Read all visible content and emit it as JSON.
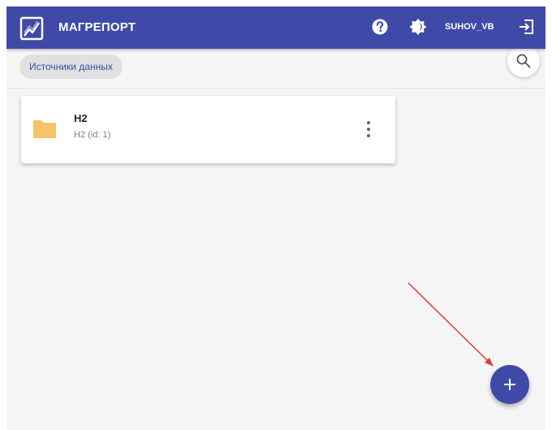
{
  "header": {
    "app_title": "МАГРЕПОРТ",
    "logo_icon": "chart-line-logo-icon",
    "help_icon": "help-circle-icon",
    "theme_icon": "theme-toggle-icon",
    "username": "SUHOV_VB",
    "logout_icon": "logout-icon"
  },
  "toolbar": {
    "breadcrumb_label": "Источники данных",
    "search_icon": "search-icon"
  },
  "cards": [
    {
      "title": "H2",
      "subtitle": "H2 (id: 1)",
      "icon": "folder-icon",
      "menu_icon": "more-vert-icon"
    }
  ],
  "fab": {
    "icon": "add-icon"
  },
  "colors": {
    "primary": "#3f4aa8",
    "background": "#f5f5f5",
    "folder": "#f6c467",
    "annotation_arrow": "#e53935"
  }
}
